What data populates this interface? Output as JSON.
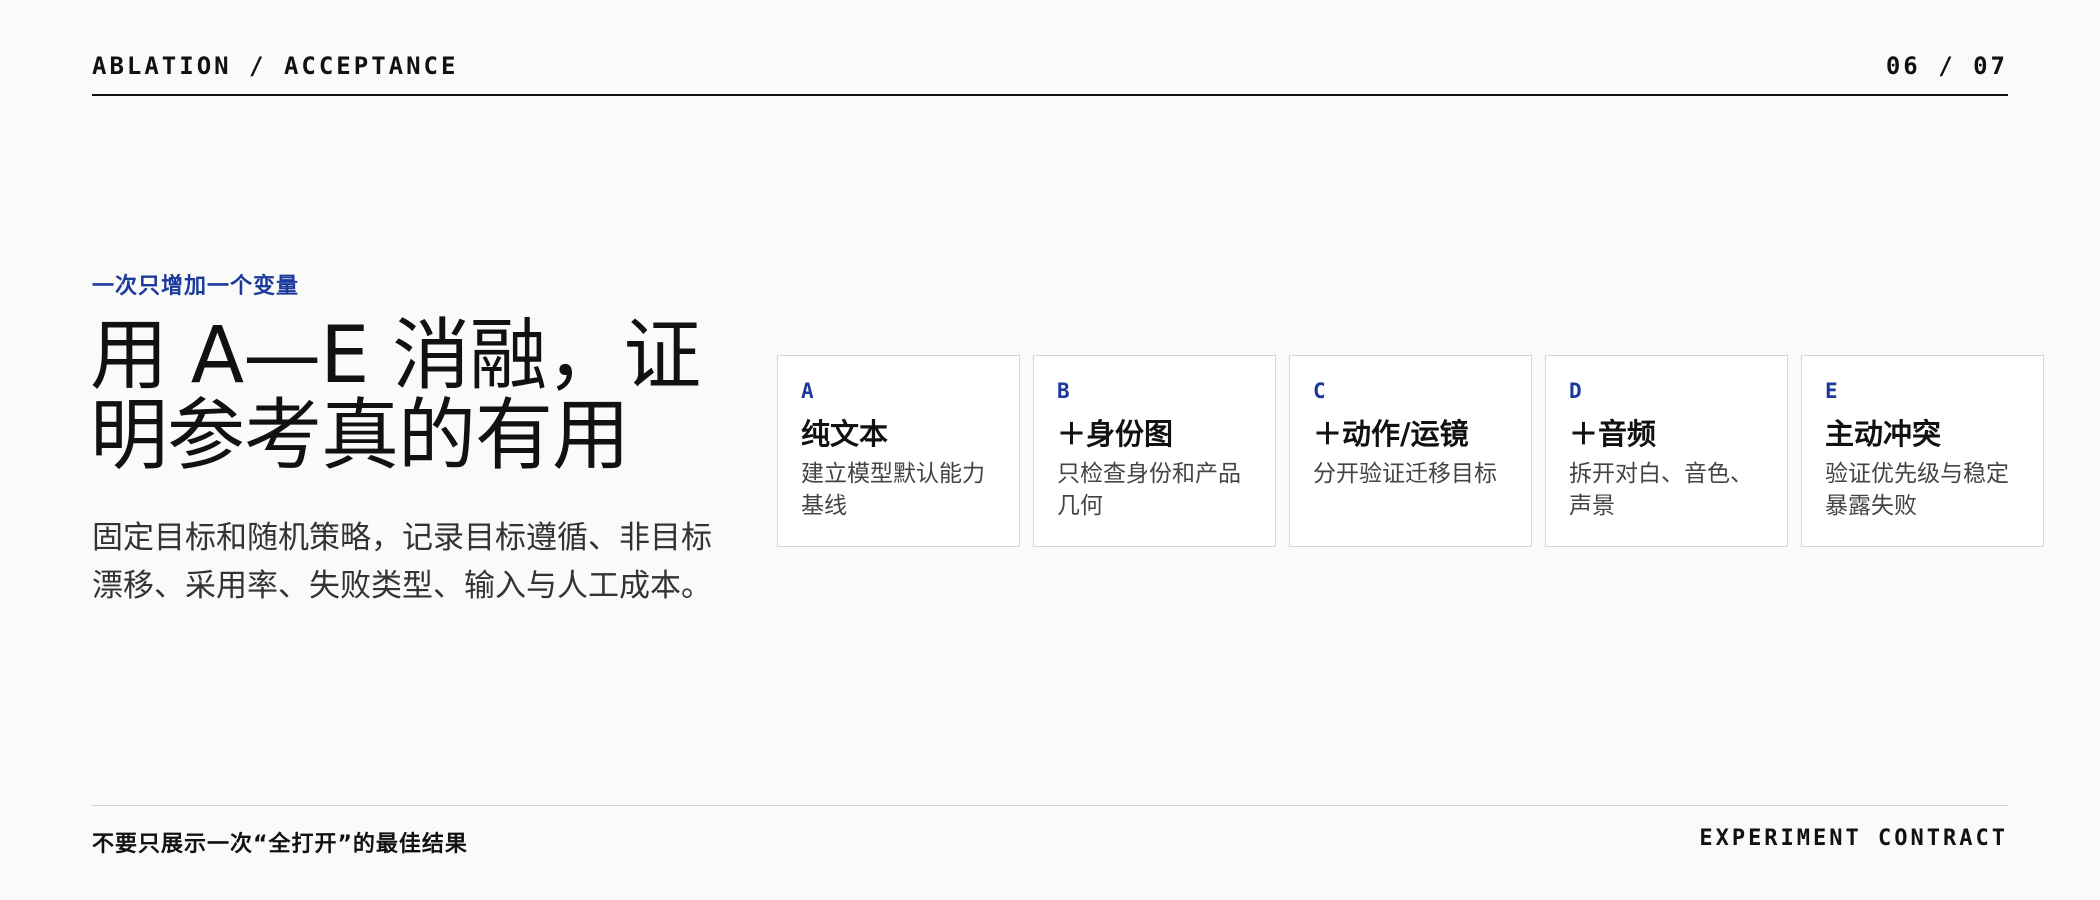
{
  "header": {
    "eyebrow": "ABLATION / ACCEPTANCE",
    "page_indicator": "06 / 07"
  },
  "intro": {
    "kicker": "一次只增加一个变量",
    "headline_line1": "用 A—E 消融，证",
    "headline_line2": "明参考真的有用",
    "lede": "固定目标和随机策略，记录目标遵循、非目标漂移、采用率、失败类型、输入与人工成本。"
  },
  "cards": [
    {
      "letter": "A",
      "title": "纯文本",
      "desc": "建立模型默认能力基线"
    },
    {
      "letter": "B",
      "title": "＋身份图",
      "desc": "只检查身份和产品几何"
    },
    {
      "letter": "C",
      "title": "＋动作/运镜",
      "desc": "分开验证迁移目标"
    },
    {
      "letter": "D",
      "title": "＋音频",
      "desc": "拆开对白、音色、声景"
    },
    {
      "letter": "E",
      "title": "主动冲突",
      "desc": "验证优先级与稳定暴露失败"
    }
  ],
  "footer": {
    "note": "不要只展示一次“全打开”的最佳结果",
    "contract": "EXPERIMENT CONTRACT"
  },
  "colors": {
    "accent": "#1b3a9c",
    "background": "#fafaf8",
    "text": "#111111"
  }
}
